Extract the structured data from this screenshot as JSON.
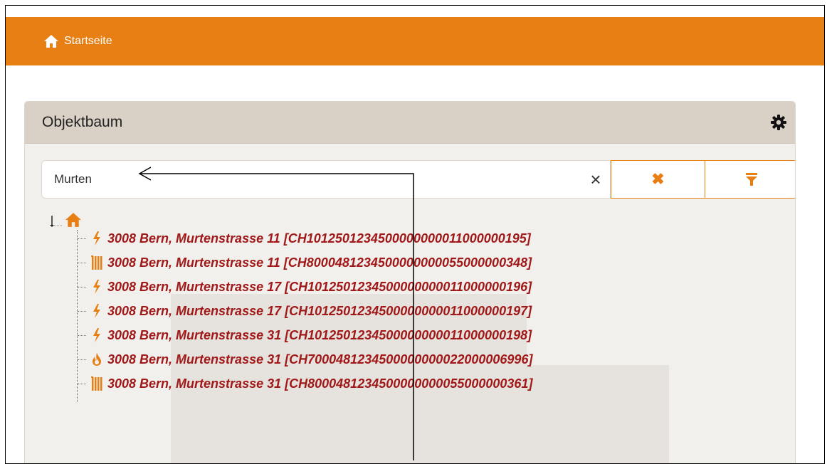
{
  "header": {
    "home_label": "Startseite",
    "accent": "#E87F14"
  },
  "panel": {
    "title": "Objektbaum"
  },
  "search": {
    "value": "Murten",
    "clear_symbol": "×",
    "reset_symbol": "✖"
  },
  "tree": {
    "items": [
      {
        "icon": "bolt-icon",
        "label": "3008 Bern, Murtenstrasse 11 [CH1012501234500000000011000000195]"
      },
      {
        "icon": "radiator-icon",
        "label": "3008 Bern, Murtenstrasse 11 [CH8000481234500000000055000000348]"
      },
      {
        "icon": "bolt-icon",
        "label": "3008 Bern, Murtenstrasse 17 [CH1012501234500000000011000000196]"
      },
      {
        "icon": "bolt-icon",
        "label": "3008 Bern, Murtenstrasse 17 [CH1012501234500000000011000000197]"
      },
      {
        "icon": "bolt-icon",
        "label": "3008 Bern, Murtenstrasse 31 [CH1012501234500000000011000000198]"
      },
      {
        "icon": "flame-icon",
        "label": "3008 Bern, Murtenstrasse 31 [CH7000481234500000000022000006996]"
      },
      {
        "icon": "radiator-icon",
        "label": "3008 Bern, Murtenstrasse 31 [CH8000481234500000000055000000361]"
      }
    ]
  }
}
